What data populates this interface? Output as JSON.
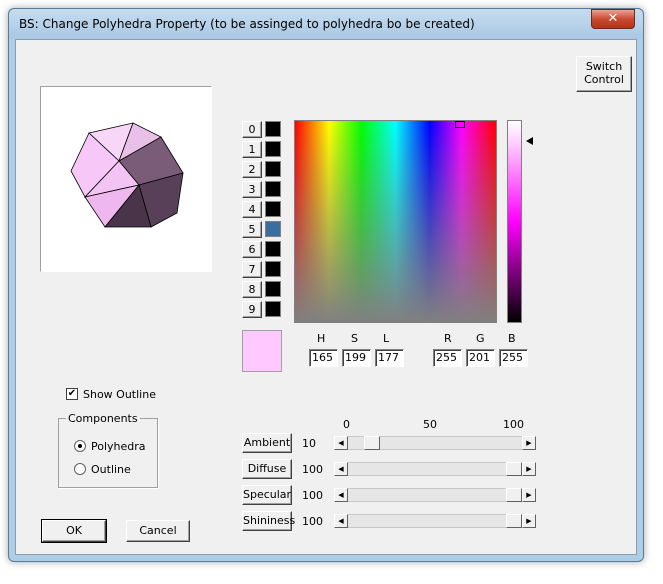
{
  "window": {
    "title": "BS: Change Polyhedra Property (to be assinged to polyhedra bo be created)",
    "close_label": "✕"
  },
  "switch_control": {
    "line1": "Switch",
    "line2": "Control"
  },
  "palette": {
    "buttons": [
      "0",
      "1",
      "2",
      "3",
      "4",
      "5",
      "6",
      "7",
      "8",
      "9"
    ],
    "swatch_colors": [
      "#000000",
      "#000000",
      "#000000",
      "#000000",
      "#000000",
      "#3b6ea0",
      "#000000",
      "#000000",
      "#000000",
      "#000000"
    ]
  },
  "color": {
    "preview_color": "#ffc9ff",
    "labels": {
      "h": "H",
      "s": "S",
      "l": "L",
      "r": "R",
      "g": "G",
      "b": "B"
    },
    "values": {
      "h": "165",
      "s": "199",
      "l": "177",
      "r": "255",
      "g": "201",
      "b": "255"
    }
  },
  "options": {
    "show_outline_label": "Show Outline",
    "show_outline_checked": true,
    "components_label": "Components",
    "radio_polyhedra": "Polyhedra",
    "radio_outline": "Outline",
    "selected_component": "Polyhedra"
  },
  "sliders": {
    "scale": {
      "min": "0",
      "mid": "50",
      "max": "100"
    },
    "items": [
      {
        "label": "Ambient",
        "value": "10",
        "level": 10
      },
      {
        "label": "Diffuse",
        "value": "100",
        "level": 100
      },
      {
        "label": "Specular",
        "value": "100",
        "level": 100
      },
      {
        "label": "Shininess",
        "value": "100",
        "level": 100
      }
    ]
  },
  "dialog": {
    "ok": "OK",
    "cancel": "Cancel"
  },
  "icons": {
    "left_arrow": "arrow-left-icon",
    "right_arrow": "arrow-right-icon",
    "checkmark": "checkmark-icon"
  }
}
